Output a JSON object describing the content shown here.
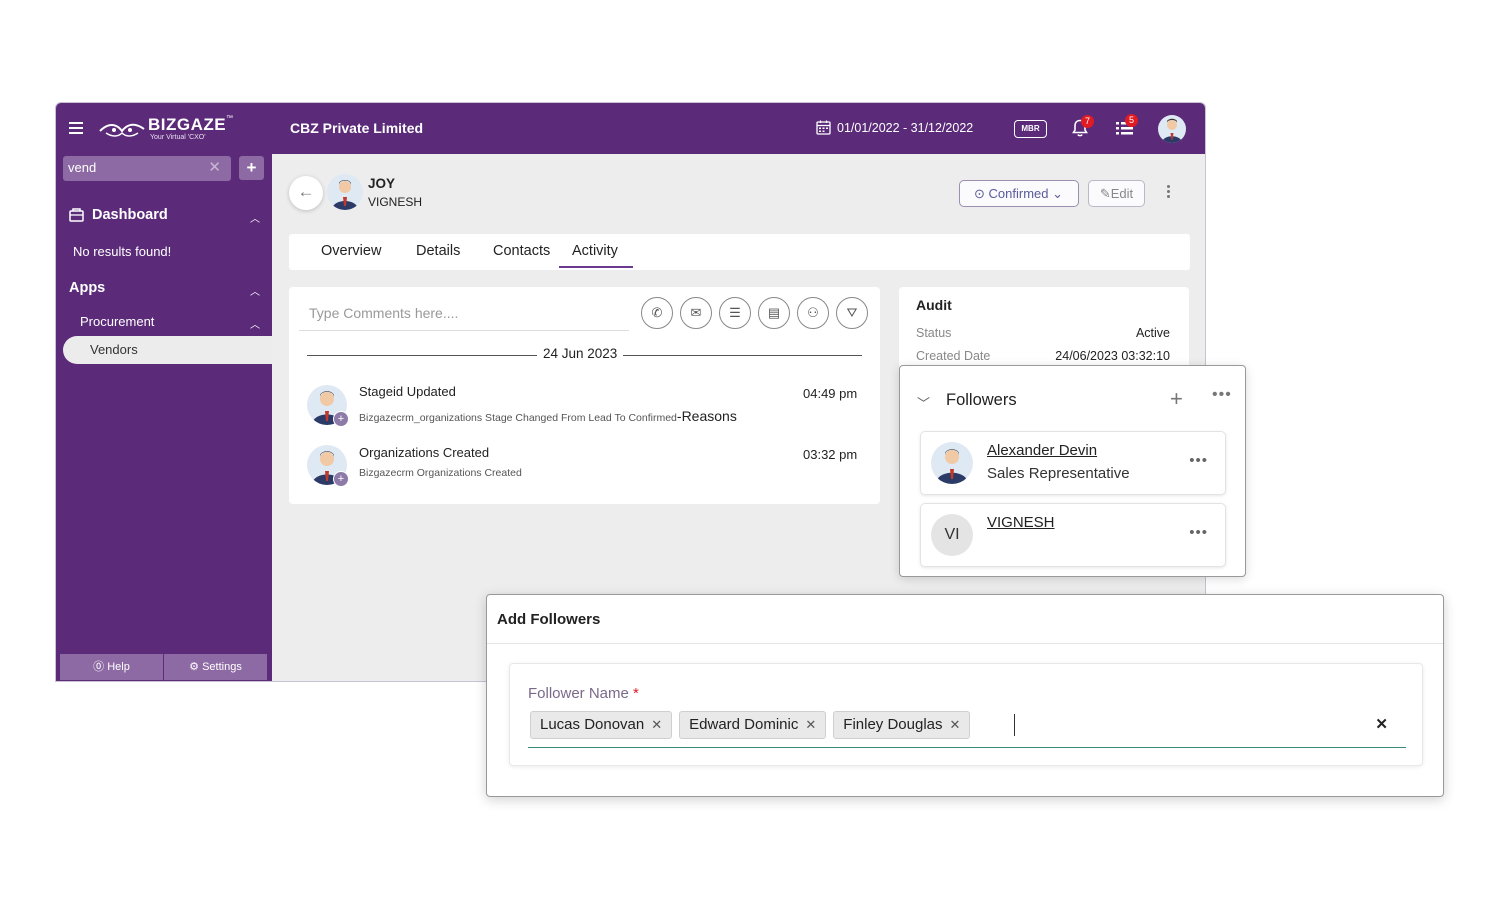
{
  "header": {
    "logo_main": "BIZGAZE",
    "logo_tm": "™",
    "logo_sub": "Your Virtual 'CXO'",
    "company": "CBZ Private Limited",
    "date_range": "01/01/2022 - 31/12/2022",
    "mbr_label": "MBR",
    "notification_count": "7",
    "task_count": "5"
  },
  "sidebar": {
    "search_value": "vend",
    "dashboard_label": "Dashboard",
    "no_results": "No results found!",
    "apps_label": "Apps",
    "procurement_label": "Procurement",
    "vendors_label": "Vendors",
    "help_label": "Help",
    "settings_label": "Settings"
  },
  "record": {
    "name": "JOY",
    "subname": "VIGNESH",
    "status_label": "Confirmed",
    "edit_label": "Edit"
  },
  "tabs": [
    {
      "label": "Overview"
    },
    {
      "label": "Details"
    },
    {
      "label": "Contacts"
    },
    {
      "label": "Activity"
    }
  ],
  "activity": {
    "comment_placeholder": "Type Comments here....",
    "date_header": "24 Jun 2023",
    "entries": [
      {
        "title": "Stageid Updated",
        "desc": "Bizgazecrm_organizations Stage Changed From Lead To Confirmed",
        "desc_suffix": "-Reasons",
        "time": "04:49 pm"
      },
      {
        "title": "Organizations Created",
        "desc": "Bizgazecrm Organizations Created",
        "time": "03:32 pm"
      }
    ]
  },
  "audit": {
    "title": "Audit",
    "status_label": "Status",
    "status_value": "Active",
    "created_label": "Created Date",
    "created_value": "24/06/2023 03:32:10"
  },
  "followers": {
    "title": "Followers",
    "items": [
      {
        "name": "Alexander Devin",
        "role": "Sales Representative"
      },
      {
        "initials": "VI",
        "name": "VIGNESH"
      }
    ]
  },
  "add_followers": {
    "title": "Add Followers",
    "field_label": "Follower Name",
    "required_mark": "*",
    "chips": [
      "Lucas Donovan",
      "Edward Dominic",
      "Finley Douglas"
    ]
  },
  "colors": {
    "brand": "#5b2a79",
    "brand_light": "#8e6aa4",
    "badge": "#e01b24"
  }
}
